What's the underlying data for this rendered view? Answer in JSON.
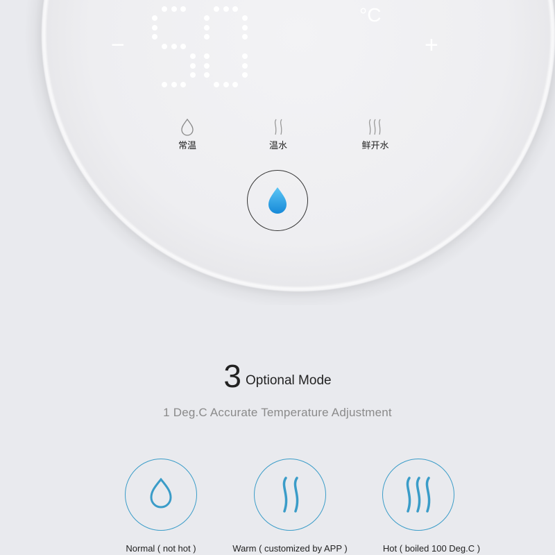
{
  "display": {
    "temperature": "50",
    "unit": "°C",
    "minus": "−",
    "plus": "+"
  },
  "panel_modes": [
    {
      "icon": "drop-icon",
      "label": "常温"
    },
    {
      "icon": "steam-2-icon",
      "label": "温水"
    },
    {
      "icon": "steam-3-icon",
      "label": "鲜开水"
    }
  ],
  "dispense_button": {
    "icon": "water-drop-icon",
    "color": "#1e9be0"
  },
  "heading": {
    "number": "3",
    "text": "Optional Mode"
  },
  "subtitle": "1 Deg.C Accurate Temperature Adjustment",
  "options": [
    {
      "icon": "drop-icon",
      "label": "Normal ( not hot )"
    },
    {
      "icon": "steam-2-icon",
      "label": "Warm ( customized by APP )"
    },
    {
      "icon": "steam-3-icon",
      "label": "Hot ( boiled 100 Deg.C )"
    }
  ],
  "colors": {
    "accent": "#3a9cc8",
    "background": "#e9eaee"
  }
}
